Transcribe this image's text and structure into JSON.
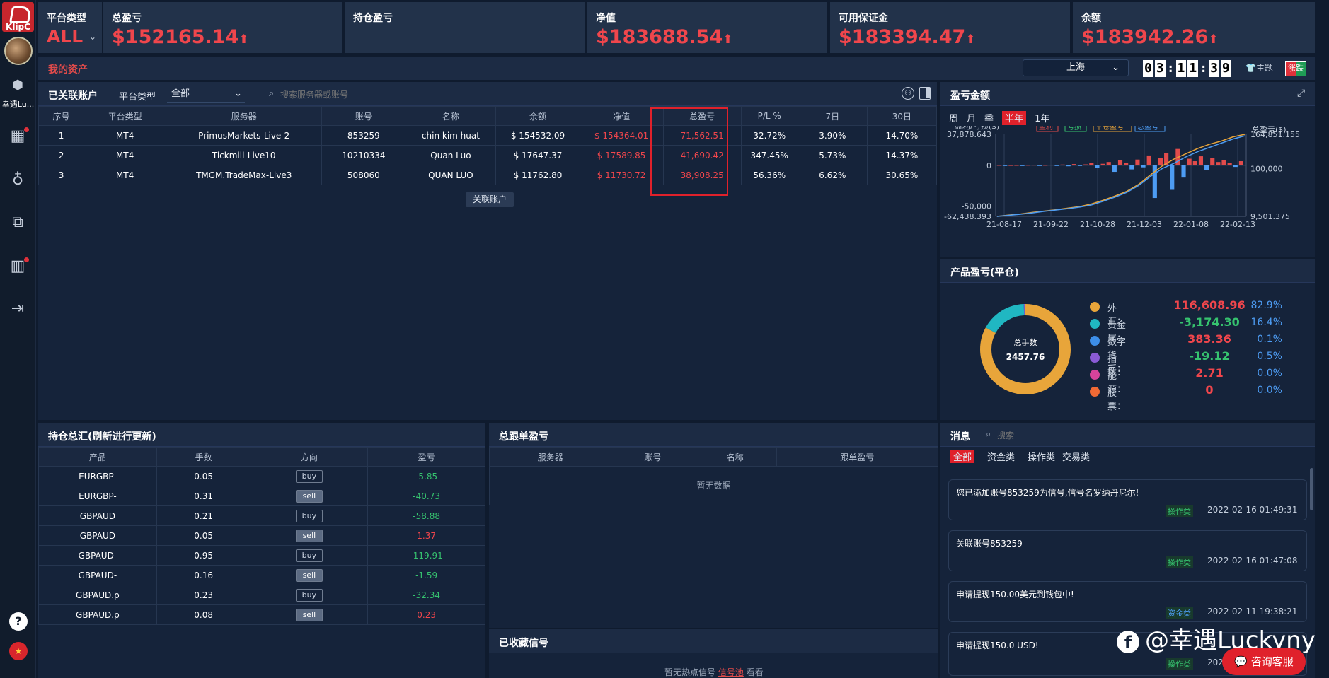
{
  "brand": {
    "logo_text": "KlipC",
    "user_name": "幸遇Lu..."
  },
  "kpis": {
    "platform_type_label": "平台类型",
    "platform_type_value": "ALL",
    "total_pl_label": "总盈亏",
    "total_pl_value": "$152165.14",
    "position_pl_label": "持仓盈亏",
    "equity_label": "净值",
    "equity_value": "$183688.54",
    "available_margin_label": "可用保证金",
    "available_margin_value": "$183394.47",
    "balance_label": "余额",
    "balance_value": "$183942.26"
  },
  "assets_bar": {
    "title": "我的资产",
    "timezone": "上海",
    "clock": [
      "0",
      "3",
      "1",
      "1",
      "3",
      "9"
    ],
    "theme_label": "主题",
    "rise_fall_label": "涨跌"
  },
  "accounts": {
    "title": "已关联账户",
    "platform_filter_label": "平台类型",
    "platform_filter_value": "全部",
    "search_placeholder": "搜索服务器或账号",
    "columns": [
      "序号",
      "平台类型",
      "服务器",
      "账号",
      "名称",
      "余额",
      "净值",
      "总盈亏",
      "P/L %",
      "7日",
      "30日"
    ],
    "rows": [
      [
        "1",
        "MT4",
        "PrimusMarkets-Live-2",
        "853259",
        "chin kim huat",
        "$ 154532.09",
        "$ 154364.01",
        "71,562.51",
        "32.72%",
        "3.90%",
        "14.70%"
      ],
      [
        "2",
        "MT4",
        "Tickmill-Live10",
        "10210334",
        "Quan Luo",
        "$ 17647.37",
        "$ 17589.85",
        "41,690.42",
        "347.45%",
        "5.73%",
        "14.37%"
      ],
      [
        "3",
        "MT4",
        "TMGM.TradeMax-Live3",
        "508060",
        "QUAN LUO",
        "$ 11762.80",
        "$ 11730.72",
        "38,908.25",
        "56.36%",
        "6.62%",
        "30.65%"
      ]
    ],
    "link_button": "关联账户"
  },
  "pl_chart_panel": {
    "title": "盈亏金额",
    "periods": [
      "周",
      "月",
      "季",
      "半年",
      "1年"
    ],
    "active_period": "半年",
    "left_axis_label": "盈利/亏损($)",
    "right_axis_label_1": "平仓盈亏($)",
    "right_axis_label_2": "总盈亏($)",
    "legend": [
      "盈利",
      "亏损",
      "平仓盈亏",
      "总盈亏"
    ],
    "colors": {
      "profit": "#e14b4b",
      "loss": "#36c36f",
      "closed": "#e8a53a",
      "total": "#4d9cf3"
    }
  },
  "chart_data": {
    "type": "line",
    "x_ticks": [
      "21-08-17",
      "21-09-22",
      "21-10-28",
      "21-12-03",
      "22-01-08",
      "22-02-13"
    ],
    "left_ticks": [
      "37,878.643",
      "0",
      "-50,000",
      "-62,438.393"
    ],
    "right_ticks": [
      "164,851.155",
      "100,000",
      "9,501.375"
    ],
    "ylim_left": [
      -62438.393,
      37878.643
    ],
    "ylim_right": [
      9501.375,
      164851.155
    ],
    "series": [
      {
        "name": "平仓盈亏",
        "axis": "right",
        "values": [
          9501,
          12000,
          14000,
          17000,
          19500,
          22000,
          25000,
          28000,
          33000,
          40000,
          48000,
          57000,
          70000,
          88000,
          105000,
          118000,
          128000,
          138000,
          146000,
          152000,
          160000,
          164851
        ]
      },
      {
        "name": "总盈亏",
        "axis": "right",
        "values": [
          9501,
          11500,
          13500,
          16000,
          19000,
          21500,
          24000,
          27000,
          31000,
          38000,
          46000,
          55000,
          68000,
          85000,
          100000,
          110000,
          122000,
          132000,
          140000,
          148000,
          156000,
          162000
        ]
      }
    ],
    "bars": [
      320,
      -420,
      180,
      250,
      -300,
      450,
      600,
      -500,
      380,
      700,
      -820,
      900,
      -1200,
      1500,
      -700,
      1100,
      2500,
      -3000,
      1800,
      4000,
      -8000,
      6000,
      3200,
      -5000,
      7000,
      -2500,
      12000,
      -40000,
      9000,
      15000,
      -30000,
      20000,
      -15000,
      8000,
      5000,
      11000,
      -6000,
      9000,
      4000,
      6000,
      3000,
      -2000,
      5000
    ]
  },
  "product_pl": {
    "title": "产品盈亏(平仓)",
    "donut_label": "总手数",
    "donut_value": "2457.76",
    "items": [
      {
        "name": "外汇：",
        "amount": "116,608.96",
        "pct": "82.9%",
        "color": "#e8a53a",
        "amount_color": "#f0464c",
        "share": 0.829
      },
      {
        "name": "贵金属：",
        "amount": "-3,174.30",
        "pct": "16.4%",
        "color": "#20b7c2",
        "amount_color": "#36c36f",
        "share": 0.164
      },
      {
        "name": "数字货币：",
        "amount": "383.36",
        "pct": "0.1%",
        "color": "#3d8ee8",
        "amount_color": "#f0464c",
        "share": 0.001
      },
      {
        "name": "指数：",
        "amount": "-19.12",
        "pct": "0.5%",
        "color": "#8a5bd6",
        "amount_color": "#36c36f",
        "share": 0.005
      },
      {
        "name": "能源：",
        "amount": "2.71",
        "pct": "0.0%",
        "color": "#d6439b",
        "amount_color": "#f0464c",
        "share": 0.0
      },
      {
        "name": "股票：",
        "amount": "0",
        "pct": "0.0%",
        "color": "#f06a35",
        "amount_color": "#f0464c",
        "share": 0.0
      }
    ]
  },
  "positions": {
    "title": "持仓总汇(刷新进行更新)",
    "columns": [
      "产品",
      "手数",
      "方向",
      "盈亏"
    ],
    "rows": [
      [
        "EURGBP-",
        "0.05",
        "buy",
        "-5.85"
      ],
      [
        "EURGBP-",
        "0.31",
        "sell",
        "-40.73"
      ],
      [
        "GBPAUD",
        "0.21",
        "buy",
        "-58.88"
      ],
      [
        "GBPAUD",
        "0.05",
        "sell",
        "1.37"
      ],
      [
        "GBPAUD-",
        "0.95",
        "buy",
        "-119.91"
      ],
      [
        "GBPAUD-",
        "0.16",
        "sell",
        "-1.59"
      ],
      [
        "GBPAUD.p",
        "0.23",
        "buy",
        "-32.34"
      ],
      [
        "GBPAUD.p",
        "0.08",
        "sell",
        "0.23"
      ]
    ]
  },
  "follow_pl": {
    "title": "总跟单盈亏",
    "columns": [
      "服务器",
      "账号",
      "名称",
      "跟单盈亏"
    ],
    "empty": "暂无数据"
  },
  "signals": {
    "title": "已收藏信号",
    "empty_prefix": "暂无热点信号",
    "empty_link": "信号池",
    "empty_suffix": "看看"
  },
  "messages": {
    "title": "消息",
    "search_placeholder": "搜索",
    "tabs": [
      "全部",
      "资金类",
      "操作类",
      "交易类"
    ],
    "items": [
      {
        "text": "您已添加账号853259为信号,信号名罗纳丹尼尔!",
        "category": "操作类",
        "time": "2022-02-16 01:49:31",
        "cat_color": "#36c36f"
      },
      {
        "text": "关联账号853259",
        "category": "操作类",
        "time": "2022-02-16 01:47:08",
        "cat_color": "#36c36f"
      },
      {
        "text": "申请提现150.00美元到钱包中!",
        "category": "资金类",
        "time": "2022-02-11 19:38:21",
        "cat_color": "#4d9cf3"
      },
      {
        "text": "申请提现150.0 USD!",
        "category": "操作类",
        "time": "202",
        "cat_color": "#36c36f"
      }
    ]
  },
  "watermark": "@幸遇Luckyny",
  "consult_button": "咨询客服"
}
